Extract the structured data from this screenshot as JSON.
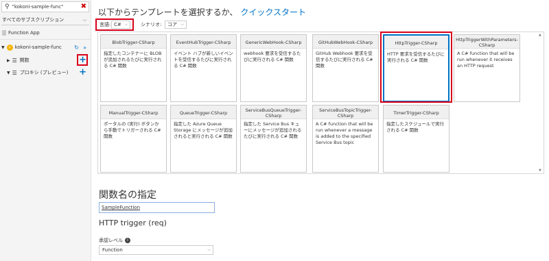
{
  "sidebar": {
    "search_value": "\"kokoni-sample-func\"",
    "subscription": "すべてのサブスクリプション",
    "function_app_label": "Function App",
    "app_name": "kokoni-sample-func",
    "functions_label": "関数",
    "proxies_label": "プロキシ (プレビュー)"
  },
  "heading": {
    "text": "以下からテンプレートを選択するか、",
    "link": "クイックスタート"
  },
  "filters": {
    "language_label": "言語:",
    "language_value": "C#",
    "scenario_label": "シナリオ:",
    "scenario_value": "コア"
  },
  "templates": [
    {
      "title": "BlobTrigger-CSharp",
      "desc": "指定したコンテナーに BLOB が追加されるたびに実行される C# 関数"
    },
    {
      "title": "EventHubTrigger-CSharp",
      "desc": "イベント ハブが新しいイベントを受信するたびに実行される C# 関数"
    },
    {
      "title": "GenericWebHook-CSharp",
      "desc": "webhook 要求を受信するたびに実行される C# 関数"
    },
    {
      "title": "GitHubWebHook-CSharp",
      "desc": "GitHub Webhook 要求を受信するたびに実行される C# 関数"
    },
    {
      "title": "HttpTrigger-CSharp",
      "desc": "HTTP 要求を受信するたびに実行される C# 関数"
    },
    {
      "title": "HttpTriggerWithParameters-CSharp",
      "desc": "A C# function that will be run whenever it receives an HTTP request"
    },
    {
      "title": "ManualTrigger-CSharp",
      "desc": "ポータルの (実行) ボタンから手動でトリガーされる C# 関数"
    },
    {
      "title": "QueueTrigger-CSharp",
      "desc": "指定した Azure Queue Storage にメッセージが追加されると実行される C# 関数"
    },
    {
      "title": "ServiceBusQueueTrigger-CSharp",
      "desc": "指定した Service Bus キューにメッセージが追加されるたびに実行される C# 関数"
    },
    {
      "title": "ServiceBusTopicTrigger-CSharp",
      "desc": "A C# function that will be run whenever a message is added to the specified Service Bus topic"
    },
    {
      "title": "TimerTrigger-CSharp",
      "desc": "指定したスケジュールで実行される C# 関数"
    }
  ],
  "form": {
    "name_heading": "関数名の指定",
    "name_value": "SampleFunction",
    "trigger_title": "HTTP trigger (req)",
    "auth_label": "承認レベル",
    "auth_value": "Function"
  },
  "colors": {
    "accent": "#0072c6",
    "highlight": "#d8001a",
    "selected_border": "#0072c6"
  }
}
